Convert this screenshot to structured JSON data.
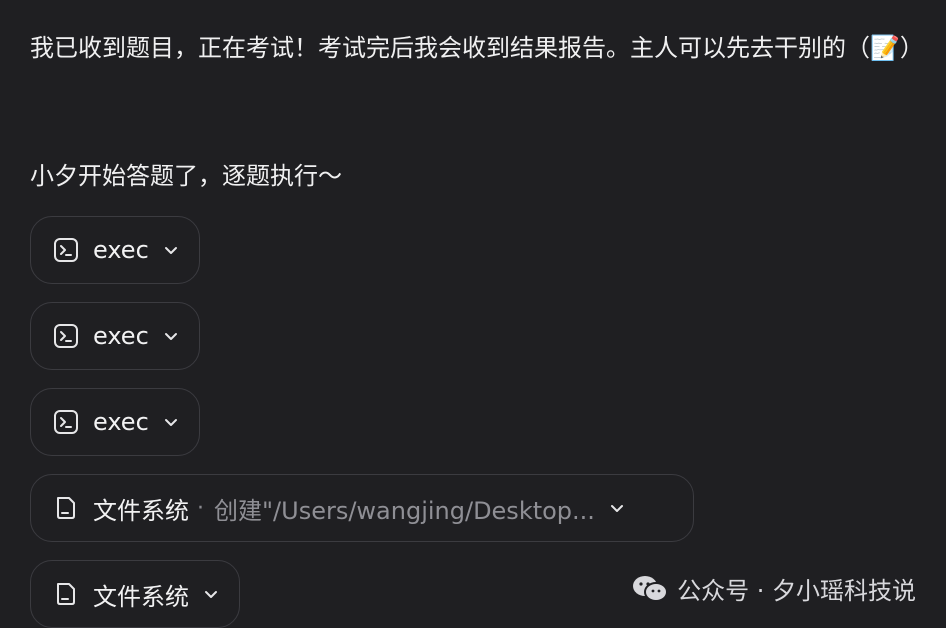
{
  "message": {
    "line1": "我已收到题目，正在考试！考试完后我会收到结果报告。主人可以先去干别的（📝）",
    "line2": "小夕开始答题了，逐题执行～"
  },
  "tools": [
    {
      "label": "exec",
      "icon": "terminal-icon"
    },
    {
      "label": "exec",
      "icon": "terminal-icon"
    },
    {
      "label": "exec",
      "icon": "terminal-icon"
    },
    {
      "label": "文件系统",
      "separator": "·",
      "detail": "创建\"/Users/wangjing/Desktop...",
      "icon": "file-icon"
    },
    {
      "label": "文件系统",
      "icon": "file-icon"
    }
  ],
  "watermark": {
    "text": "公众号 · 夕小瑶科技说",
    "icon": "wechat-icon"
  }
}
